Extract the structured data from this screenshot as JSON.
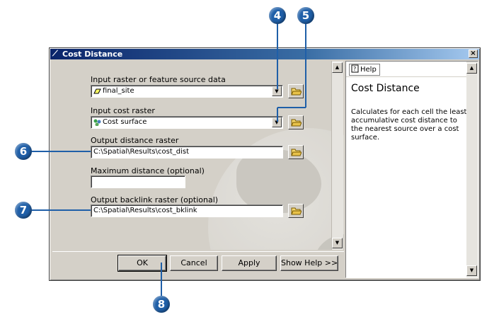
{
  "window": {
    "title": "Cost Distance",
    "close_label": "×"
  },
  "form": {
    "input_source": {
      "label": "Input raster or feature source data",
      "value": "final_site",
      "icon": "feature-line-icon"
    },
    "input_cost": {
      "label": "Input cost raster",
      "value": "Cost surface",
      "icon": "raster-icon"
    },
    "output_distance": {
      "label": "Output distance raster",
      "value": "C:\\Spatial\\Results\\cost_dist"
    },
    "max_distance": {
      "label": "Maximum distance (optional)",
      "value": ""
    },
    "output_backlink": {
      "label": "Output backlink raster (optional)",
      "value": "C:\\Spatial\\Results\\cost_bklink"
    }
  },
  "buttons": {
    "ok": "OK",
    "cancel": "Cancel",
    "apply": "Apply",
    "show_help": "Show Help >>"
  },
  "help": {
    "tab_label": "Help",
    "title": "Cost Distance",
    "description": "Calculates for each cell the least accumulative cost distance to the nearest source over a cost surface."
  },
  "callouts": [
    "4",
    "5",
    "6",
    "7",
    "8"
  ],
  "colors": {
    "callout": "#1f5fa8",
    "titlebar": "#0a246a"
  }
}
